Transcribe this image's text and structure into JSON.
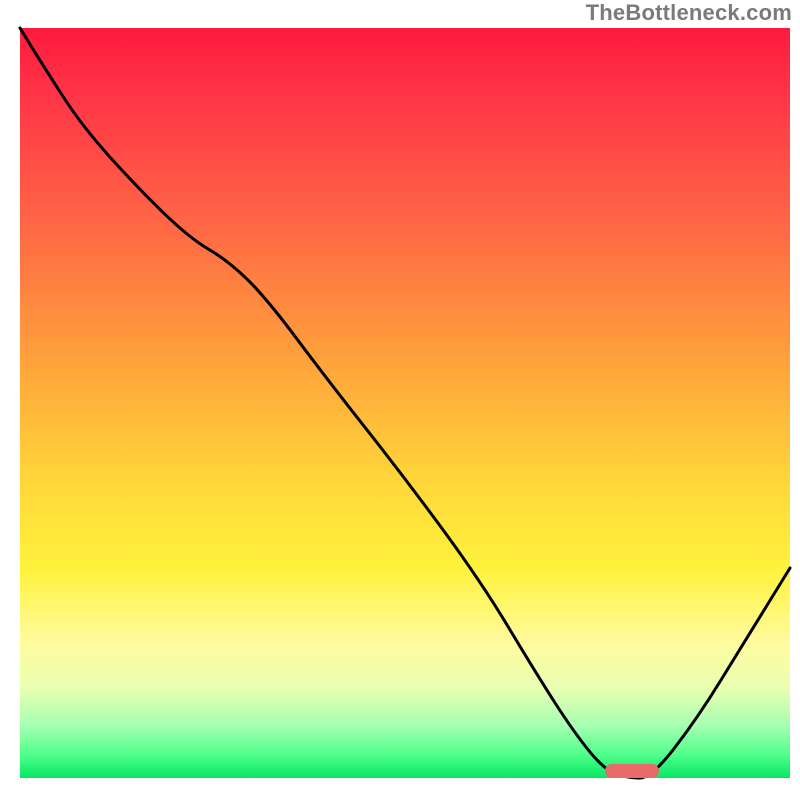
{
  "watermark": "TheBottleneck.com",
  "chart_data": {
    "type": "line",
    "title": "",
    "xlabel": "",
    "ylabel": "",
    "xlim": [
      0,
      100
    ],
    "ylim": [
      0,
      100
    ],
    "grid": false,
    "legend": false,
    "background_gradient_stops": [
      {
        "pct": 0,
        "color": "#fe1a3e"
      },
      {
        "pct": 8,
        "color": "#ff3246"
      },
      {
        "pct": 25,
        "color": "#ff6346"
      },
      {
        "pct": 45,
        "color": "#ffa43b"
      },
      {
        "pct": 60,
        "color": "#ffd53a"
      },
      {
        "pct": 72,
        "color": "#fff23c"
      },
      {
        "pct": 82,
        "color": "#fffb9e"
      },
      {
        "pct": 88,
        "color": "#e9ffb2"
      },
      {
        "pct": 93,
        "color": "#a6ffb2"
      },
      {
        "pct": 97,
        "color": "#4dff8a"
      },
      {
        "pct": 100,
        "color": "#06e763"
      }
    ],
    "series": [
      {
        "name": "bottleneck-curve",
        "x": [
          0,
          3,
          8,
          15,
          22,
          27,
          32,
          40,
          50,
          60,
          67,
          72,
          76,
          79,
          82,
          88,
          94,
          100
        ],
        "y": [
          100,
          95,
          87,
          79,
          72,
          69,
          64,
          53,
          40,
          26,
          14,
          6,
          1,
          0,
          0,
          8,
          18,
          28
        ]
      }
    ],
    "marker": {
      "x_start": 76,
      "x_end": 83,
      "y": 1,
      "color": "#e86a6a"
    }
  },
  "icons": {
    "marker_name": "optimal-range-marker"
  }
}
